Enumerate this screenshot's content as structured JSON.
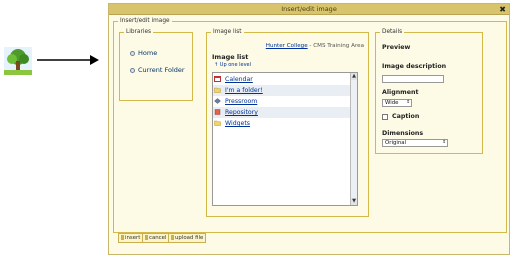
{
  "annotation": {
    "tree_icon": "tree-icon",
    "arrow_icon": "arrow-icon"
  },
  "dialog": {
    "title": "Insert/edit image",
    "close_label": "✖",
    "outer_legend": "Insert/edit image"
  },
  "libraries": {
    "legend": "Libraries",
    "items": [
      {
        "label": "Home",
        "icon": "radio-icon"
      },
      {
        "label": "Current Folder",
        "icon": "radio-icon"
      }
    ]
  },
  "image_list": {
    "legend": "Image list",
    "crumb_link": "Hunter College",
    "crumb_rest": " - CMS Training Area",
    "heading": "Image list",
    "up_level": "Up one level",
    "files": [
      {
        "name": "Calendar",
        "icon": "calendar-icon"
      },
      {
        "name": "I'm a folder!",
        "icon": "folder-icon"
      },
      {
        "name": "Pressroom",
        "icon": "pressroom-icon"
      },
      {
        "name": "Repository",
        "icon": "repository-icon"
      },
      {
        "name": "Widgets",
        "icon": "folder-icon"
      }
    ]
  },
  "details": {
    "legend": "Details",
    "preview": "Preview",
    "description_label": "Image description",
    "description_value": "",
    "alignment_label": "Alignment",
    "alignment_value": "Wide",
    "caption_label": "Caption",
    "caption_checked": false,
    "dimensions_label": "Dimensions",
    "dimensions_value": "Original"
  },
  "buttons": {
    "insert": "insert",
    "cancel": "cancel",
    "upload": "upload file"
  },
  "colors": {
    "titlebar": "#d8c46d",
    "border": "#d3b94a",
    "link": "#003399"
  }
}
